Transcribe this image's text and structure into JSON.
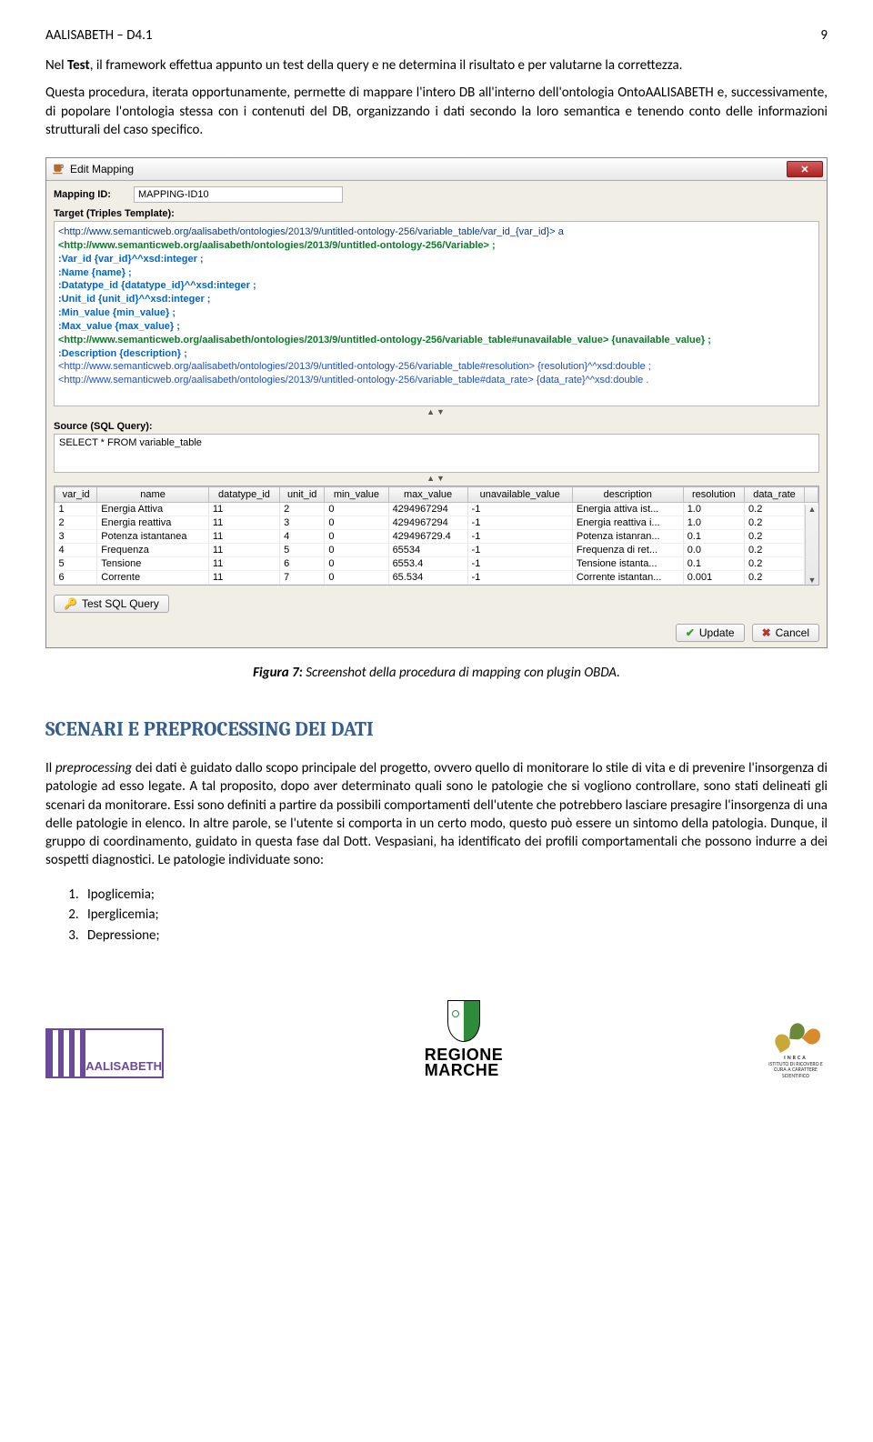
{
  "header": {
    "doc_title": "AALISABETH – D4.1",
    "page_num": "9"
  },
  "para1_pre": "Nel ",
  "para1_bold": "Test",
  "para1_post": ", il framework effettua appunto un test della query e ne determina il risultato e per valutarne la correttezza.",
  "para2": "Questa procedura, iterata opportunamente, permette di mappare l'intero DB all'interno dell'ontologia OntoAALISABETH e, successivamente, di popolare l'ontologia stessa con i contenuti del DB, organizzando i dati secondo la loro semantica e tenendo conto delle informazioni strutturali del caso specifico.",
  "win": {
    "title": "Edit Mapping",
    "mapping_id_label": "Mapping ID:",
    "mapping_id_value": "MAPPING-ID10",
    "target_label": "Target (Triples Template):",
    "triples": [
      {
        "cls": "uri-dark",
        "text": "<http://www.semanticweb.org/aalisabeth/ontologies/2013/9/untitled-ontology-256/variable_table/var_id_{var_id}> a"
      },
      {
        "cls": "uri-green",
        "text": "<http://www.semanticweb.org/aalisabeth/ontologies/2013/9/untitled-ontology-256/Variable> ;"
      },
      {
        "cls": "colon-field",
        "text": ":Var_id {var_id}^^xsd:integer ;"
      },
      {
        "cls": "colon-field",
        "text": ":Name {name} ;"
      },
      {
        "cls": "colon-field",
        "text": ":Datatype_id {datatype_id}^^xsd:integer ;"
      },
      {
        "cls": "colon-field",
        "text": ":Unit_id {unit_id}^^xsd:integer ;"
      },
      {
        "cls": "colon-field",
        "text": ":Min_value {min_value} ;"
      },
      {
        "cls": "colon-field",
        "text": ":Max_value {max_value} ;"
      },
      {
        "cls": "uri-green",
        "text": "<http://www.semanticweb.org/aalisabeth/ontologies/2013/9/untitled-ontology-256/variable_table#unavailable_value> {unavailable_value} ;"
      },
      {
        "cls": "colon-field",
        "text": ":Description {description} ;"
      },
      {
        "cls": "uri-blue",
        "text": "<http://www.semanticweb.org/aalisabeth/ontologies/2013/9/untitled-ontology-256/variable_table#resolution> {resolution}^^xsd:double ;"
      },
      {
        "cls": "uri-blue",
        "text": "<http://www.semanticweb.org/aalisabeth/ontologies/2013/9/untitled-ontology-256/variable_table#data_rate> {data_rate}^^xsd:double ."
      }
    ],
    "source_label": "Source (SQL Query):",
    "sql": "SELECT * FROM variable_table",
    "columns": [
      "var_id",
      "name",
      "datatype_id",
      "unit_id",
      "min_value",
      "max_value",
      "unavailable_value",
      "description",
      "resolution",
      "data_rate"
    ],
    "rows": [
      [
        "1",
        "Energia Attiva",
        "11",
        "2",
        "0",
        "4294967294",
        "-1",
        "Energia attiva ist...",
        "1.0",
        "0.2"
      ],
      [
        "2",
        "Energia reattiva",
        "11",
        "3",
        "0",
        "4294967294",
        "-1",
        "Energia reattiva i...",
        "1.0",
        "0.2"
      ],
      [
        "3",
        "Potenza istantanea",
        "11",
        "4",
        "0",
        "429496729.4",
        "-1",
        "Potenza istanran...",
        "0.1",
        "0.2"
      ],
      [
        "4",
        "Frequenza",
        "11",
        "5",
        "0",
        "65534",
        "-1",
        "Frequenza di ret...",
        "0.0",
        "0.2"
      ],
      [
        "5",
        "Tensione",
        "11",
        "6",
        "0",
        "6553.4",
        "-1",
        "Tensione istanta...",
        "0.1",
        "0.2"
      ],
      [
        "6",
        "Corrente",
        "11",
        "7",
        "0",
        "65.534",
        "-1",
        "Corrente istantan...",
        "0.001",
        "0.2"
      ]
    ],
    "test_btn": "Test SQL Query",
    "update_btn": "Update",
    "cancel_btn": "Cancel"
  },
  "figure_label": "Figura 7:",
  "figure_text": " Screenshot della procedura di mapping con plugin OBDA.",
  "section_heading": "SCENARI E PREPROCESSING DEI DATI",
  "para3_pre": "Il ",
  "para3_italic": "preprocessing",
  "para3_post": " dei dati è guidato dallo scopo principale del progetto, ovvero quello di monitorare lo stile di vita e di prevenire l'insorgenza di patologie ad esso legate. A tal proposito, dopo aver determinato quali sono le patologie che si vogliono controllare, sono stati delineati gli scenari da monitorare. Essi sono definiti a partire da possibili comportamenti dell'utente che potrebbero lasciare presagire l'insorgenza di una delle patologie in elenco. In altre parole, se l'utente si comporta in un certo modo, questo può essere un sintomo della patologia. Dunque, il gruppo di coordinamento, guidato in questa fase dal Dott. Vespasiani, ha identificato dei profili comportamentali che possono indurre a dei sospetti diagnostici. Le patologie individuate sono:",
  "pathologies": [
    "Ipoglicemia;",
    "Iperglicemia;",
    "Depressione;"
  ],
  "logos": {
    "left_text": "AALISABETH",
    "center_line1": "REGIONE",
    "center_line2": "MARCHE",
    "right_line1": "INRCA",
    "right_line2": "ISTITUTO DI RICOVERO E CURA A CARATTERE SCIENTIFICO"
  },
  "chart_data": {
    "type": "table",
    "title": "variable_table preview",
    "columns": [
      "var_id",
      "name",
      "datatype_id",
      "unit_id",
      "min_value",
      "max_value",
      "unavailable_value",
      "description",
      "resolution",
      "data_rate"
    ],
    "rows": [
      [
        1,
        "Energia Attiva",
        11,
        2,
        0,
        4294967294,
        -1,
        "Energia attiva ist...",
        1.0,
        0.2
      ],
      [
        2,
        "Energia reattiva",
        11,
        3,
        0,
        4294967294,
        -1,
        "Energia reattiva i...",
        1.0,
        0.2
      ],
      [
        3,
        "Potenza istantanea",
        11,
        4,
        0,
        429496729.4,
        -1,
        "Potenza istanran...",
        0.1,
        0.2
      ],
      [
        4,
        "Frequenza",
        11,
        5,
        0,
        65534,
        -1,
        "Frequenza di ret...",
        0.0,
        0.2
      ],
      [
        5,
        "Tensione",
        11,
        6,
        0,
        6553.4,
        -1,
        "Tensione istanta...",
        0.1,
        0.2
      ],
      [
        6,
        "Corrente",
        11,
        7,
        0,
        65.534,
        -1,
        "Corrente istantan...",
        0.001,
        0.2
      ]
    ]
  }
}
